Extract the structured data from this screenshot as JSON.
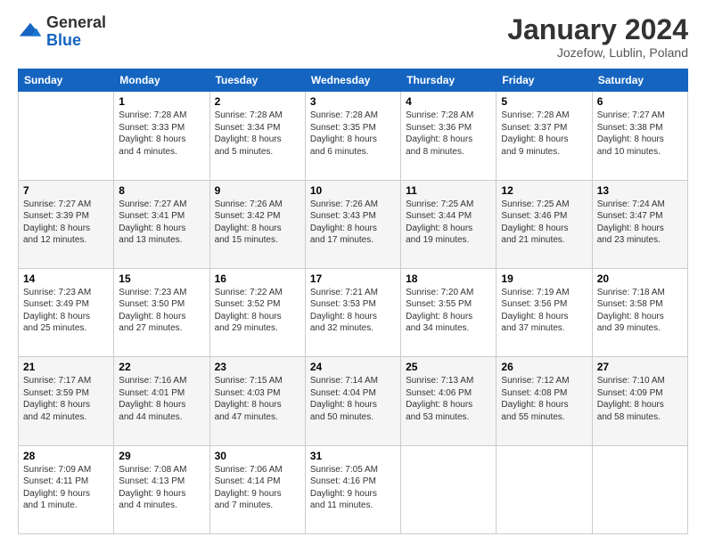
{
  "logo": {
    "line1": "General",
    "line2": "Blue"
  },
  "header": {
    "title": "January 2024",
    "subtitle": "Jozefow, Lublin, Poland"
  },
  "days_of_week": [
    "Sunday",
    "Monday",
    "Tuesday",
    "Wednesday",
    "Thursday",
    "Friday",
    "Saturday"
  ],
  "weeks": [
    [
      {
        "day": "",
        "info": ""
      },
      {
        "day": "1",
        "info": "Sunrise: 7:28 AM\nSunset: 3:33 PM\nDaylight: 8 hours\nand 4 minutes."
      },
      {
        "day": "2",
        "info": "Sunrise: 7:28 AM\nSunset: 3:34 PM\nDaylight: 8 hours\nand 5 minutes."
      },
      {
        "day": "3",
        "info": "Sunrise: 7:28 AM\nSunset: 3:35 PM\nDaylight: 8 hours\nand 6 minutes."
      },
      {
        "day": "4",
        "info": "Sunrise: 7:28 AM\nSunset: 3:36 PM\nDaylight: 8 hours\nand 8 minutes."
      },
      {
        "day": "5",
        "info": "Sunrise: 7:28 AM\nSunset: 3:37 PM\nDaylight: 8 hours\nand 9 minutes."
      },
      {
        "day": "6",
        "info": "Sunrise: 7:27 AM\nSunset: 3:38 PM\nDaylight: 8 hours\nand 10 minutes."
      }
    ],
    [
      {
        "day": "7",
        "info": "Sunrise: 7:27 AM\nSunset: 3:39 PM\nDaylight: 8 hours\nand 12 minutes."
      },
      {
        "day": "8",
        "info": "Sunrise: 7:27 AM\nSunset: 3:41 PM\nDaylight: 8 hours\nand 13 minutes."
      },
      {
        "day": "9",
        "info": "Sunrise: 7:26 AM\nSunset: 3:42 PM\nDaylight: 8 hours\nand 15 minutes."
      },
      {
        "day": "10",
        "info": "Sunrise: 7:26 AM\nSunset: 3:43 PM\nDaylight: 8 hours\nand 17 minutes."
      },
      {
        "day": "11",
        "info": "Sunrise: 7:25 AM\nSunset: 3:44 PM\nDaylight: 8 hours\nand 19 minutes."
      },
      {
        "day": "12",
        "info": "Sunrise: 7:25 AM\nSunset: 3:46 PM\nDaylight: 8 hours\nand 21 minutes."
      },
      {
        "day": "13",
        "info": "Sunrise: 7:24 AM\nSunset: 3:47 PM\nDaylight: 8 hours\nand 23 minutes."
      }
    ],
    [
      {
        "day": "14",
        "info": "Sunrise: 7:23 AM\nSunset: 3:49 PM\nDaylight: 8 hours\nand 25 minutes."
      },
      {
        "day": "15",
        "info": "Sunrise: 7:23 AM\nSunset: 3:50 PM\nDaylight: 8 hours\nand 27 minutes."
      },
      {
        "day": "16",
        "info": "Sunrise: 7:22 AM\nSunset: 3:52 PM\nDaylight: 8 hours\nand 29 minutes."
      },
      {
        "day": "17",
        "info": "Sunrise: 7:21 AM\nSunset: 3:53 PM\nDaylight: 8 hours\nand 32 minutes."
      },
      {
        "day": "18",
        "info": "Sunrise: 7:20 AM\nSunset: 3:55 PM\nDaylight: 8 hours\nand 34 minutes."
      },
      {
        "day": "19",
        "info": "Sunrise: 7:19 AM\nSunset: 3:56 PM\nDaylight: 8 hours\nand 37 minutes."
      },
      {
        "day": "20",
        "info": "Sunrise: 7:18 AM\nSunset: 3:58 PM\nDaylight: 8 hours\nand 39 minutes."
      }
    ],
    [
      {
        "day": "21",
        "info": "Sunrise: 7:17 AM\nSunset: 3:59 PM\nDaylight: 8 hours\nand 42 minutes."
      },
      {
        "day": "22",
        "info": "Sunrise: 7:16 AM\nSunset: 4:01 PM\nDaylight: 8 hours\nand 44 minutes."
      },
      {
        "day": "23",
        "info": "Sunrise: 7:15 AM\nSunset: 4:03 PM\nDaylight: 8 hours\nand 47 minutes."
      },
      {
        "day": "24",
        "info": "Sunrise: 7:14 AM\nSunset: 4:04 PM\nDaylight: 8 hours\nand 50 minutes."
      },
      {
        "day": "25",
        "info": "Sunrise: 7:13 AM\nSunset: 4:06 PM\nDaylight: 8 hours\nand 53 minutes."
      },
      {
        "day": "26",
        "info": "Sunrise: 7:12 AM\nSunset: 4:08 PM\nDaylight: 8 hours\nand 55 minutes."
      },
      {
        "day": "27",
        "info": "Sunrise: 7:10 AM\nSunset: 4:09 PM\nDaylight: 8 hours\nand 58 minutes."
      }
    ],
    [
      {
        "day": "28",
        "info": "Sunrise: 7:09 AM\nSunset: 4:11 PM\nDaylight: 9 hours\nand 1 minute."
      },
      {
        "day": "29",
        "info": "Sunrise: 7:08 AM\nSunset: 4:13 PM\nDaylight: 9 hours\nand 4 minutes."
      },
      {
        "day": "30",
        "info": "Sunrise: 7:06 AM\nSunset: 4:14 PM\nDaylight: 9 hours\nand 7 minutes."
      },
      {
        "day": "31",
        "info": "Sunrise: 7:05 AM\nSunset: 4:16 PM\nDaylight: 9 hours\nand 11 minutes."
      },
      {
        "day": "",
        "info": ""
      },
      {
        "day": "",
        "info": ""
      },
      {
        "day": "",
        "info": ""
      }
    ]
  ]
}
